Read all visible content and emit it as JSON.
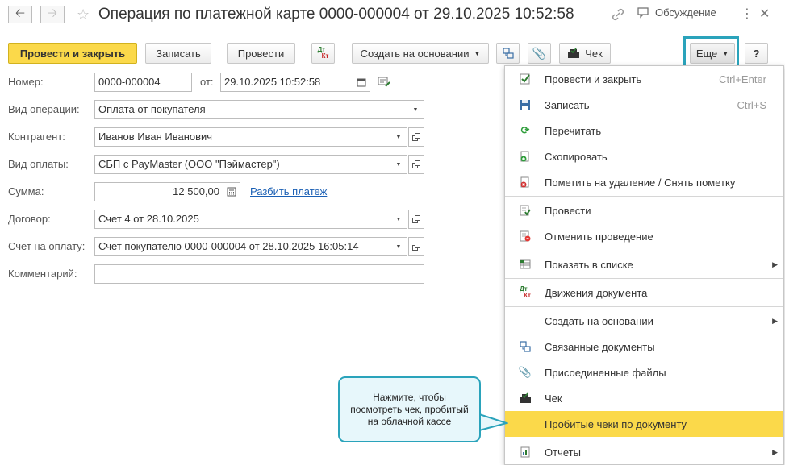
{
  "header": {
    "title": "Операция по платежной карте 0000-000004 от 29.10.2025 10:52:58",
    "discussion": "Обсуждение"
  },
  "toolbar": {
    "post_close": "Провести и закрыть",
    "save": "Записать",
    "post": "Провести",
    "create_based": "Создать на основании",
    "check": "Чек",
    "more": "Еще",
    "help": "?",
    "dt": "Дт",
    "kt": "Кт"
  },
  "form": {
    "number_label": "Номер:",
    "number_value": "0000-000004",
    "from_label": "от:",
    "date_value": "29.10.2025 10:52:58",
    "operation_label": "Вид операции:",
    "operation_value": "Оплата от покупателя",
    "counterparty_label": "Контрагент:",
    "counterparty_value": "Иванов Иван Иванович",
    "payment_type_label": "Вид оплаты:",
    "payment_type_value": "СБП с PayMaster (ООО \"Пэймастер\")",
    "sum_label": "Сумма:",
    "sum_value": "12 500,00",
    "split_link": "Разбить платеж",
    "contract_label": "Договор:",
    "contract_value": "Счет 4 от 28.10.2025",
    "invoice_label": "Счет на оплату:",
    "invoice_value": "Счет покупателю 0000-000004 от 28.10.2025 16:05:14",
    "comment_label": "Комментарий:",
    "comment_value": ""
  },
  "menu": {
    "items": [
      {
        "label": "Провести и закрыть",
        "shortcut": "Ctrl+Enter"
      },
      {
        "label": "Записать",
        "shortcut": "Ctrl+S"
      },
      {
        "label": "Перечитать"
      },
      {
        "label": "Скопировать"
      },
      {
        "label": "Пометить на удаление / Снять пометку"
      },
      {
        "label": "Провести"
      },
      {
        "label": "Отменить проведение"
      },
      {
        "label": "Показать в списке"
      },
      {
        "label": "Движения документа"
      },
      {
        "label": "Создать на основании"
      },
      {
        "label": "Связанные документы"
      },
      {
        "label": "Присоединенные файлы"
      },
      {
        "label": "Чек"
      },
      {
        "label": "Пробитые чеки по документу"
      },
      {
        "label": "Отчеты"
      }
    ]
  },
  "callout": {
    "text": "Нажмите, чтобы посмотреть чек, пробитый на облачной кассе"
  },
  "colors": {
    "accent_yellow": "#fbd94a",
    "callout_border": "#2aa3bb",
    "link": "#1a5fb4"
  }
}
